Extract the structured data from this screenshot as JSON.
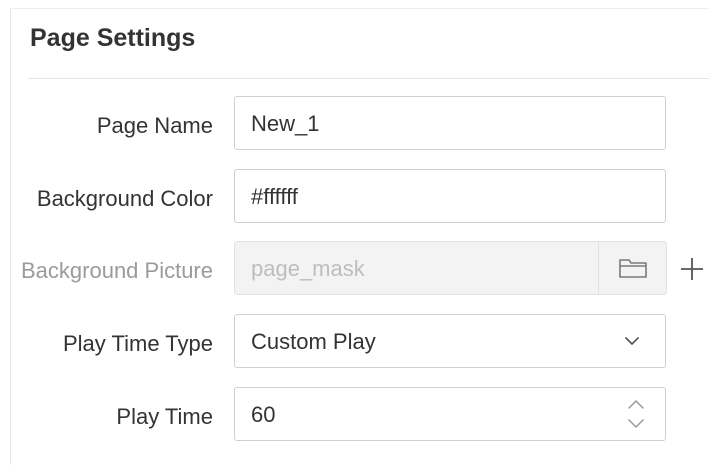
{
  "panel": {
    "title": "Page Settings"
  },
  "form": {
    "page_name": {
      "label": "Page Name",
      "value": "New_1"
    },
    "background_color": {
      "label": "Background Color",
      "value": "#ffffff"
    },
    "background_picture": {
      "label": "Background Picture",
      "value": "page_mask",
      "icon": "folder-icon",
      "add_icon": "plus-icon"
    },
    "play_time_type": {
      "label": "Play Time Type",
      "value": "Custom Play",
      "icon": "chevron-down-icon"
    },
    "play_time": {
      "label": "Play Time",
      "value": "60",
      "icon": "spinner-icon"
    }
  },
  "colors": {
    "label_text": "#333333",
    "disabled_text": "#bdbdbd",
    "border": "#cfcfcf",
    "disabled_bg": "#f3f3f3"
  }
}
